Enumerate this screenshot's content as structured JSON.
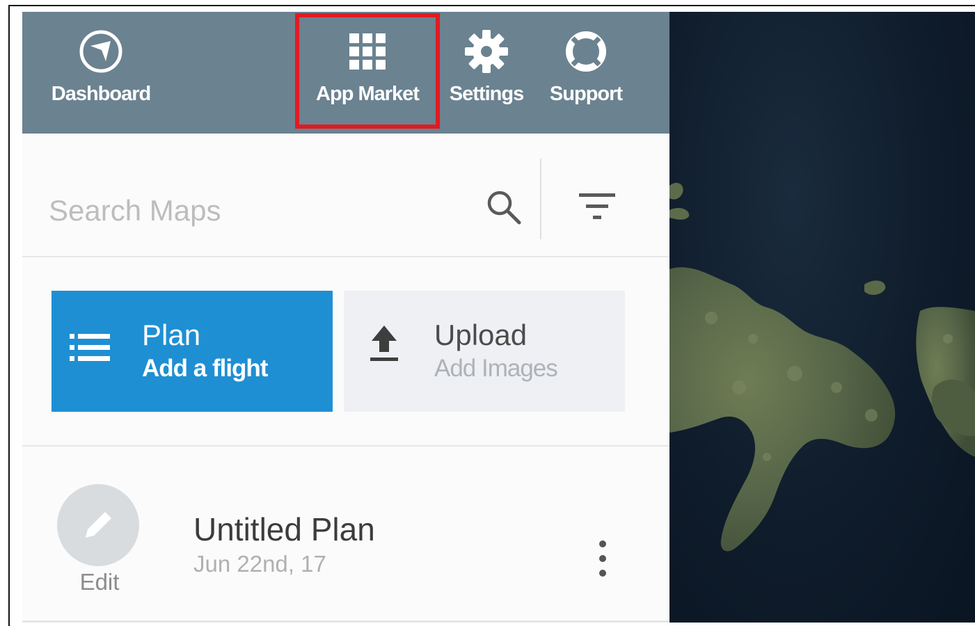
{
  "nav": {
    "items": [
      {
        "label": "Dashboard",
        "icon": "navigation-compass-icon"
      },
      {
        "label": "App Market",
        "icon": "grid-apps-icon"
      },
      {
        "label": "Settings",
        "icon": "gear-icon"
      },
      {
        "label": "Support",
        "icon": "lifebuoy-icon"
      }
    ],
    "highlighted": "App Market",
    "highlight_color": "#e01b22",
    "bar_color": "#6b8290"
  },
  "search": {
    "placeholder": "Search Maps",
    "value": ""
  },
  "actions": {
    "plan": {
      "title": "Plan",
      "subtitle": "Add a flight",
      "icon": "list-icon",
      "color": "#1f8fd3"
    },
    "upload": {
      "title": "Upload",
      "subtitle": "Add Images",
      "icon": "upload-icon"
    }
  },
  "plans": [
    {
      "title": "Untitled Plan",
      "date": "Jun 22nd, 17",
      "edit_label": "Edit"
    }
  ]
}
